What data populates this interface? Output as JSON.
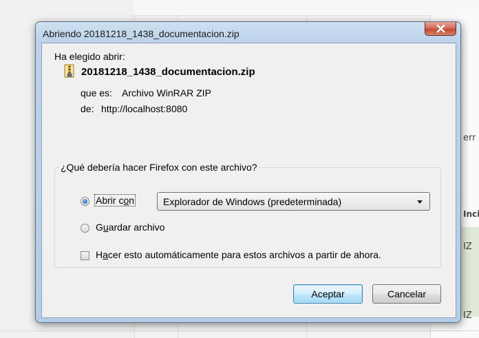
{
  "window": {
    "title": "Abriendo 20181218_1438_documentacion.zip"
  },
  "content": {
    "chosen_label": "Ha elegido abrir:",
    "file_name": "20181218_1438_documentacion.zip",
    "type_prefix": "que es:",
    "type_value": "Archivo WinRAR ZIP",
    "from_prefix": "de:",
    "from_value": "http://localhost:8080"
  },
  "group": {
    "legend": "¿Qué debería hacer Firefox con este archivo?",
    "open_with": {
      "label_before": "Abrir c",
      "label_accel": "o",
      "label_after": "n",
      "checked": true
    },
    "app_select": {
      "value": "Explorador de Windows (predeterminada)"
    },
    "save_file": {
      "label_before": "G",
      "label_accel": "u",
      "label_after": "ardar archivo",
      "checked": false
    },
    "auto": {
      "label_before": "H",
      "label_accel": "a",
      "label_after": "cer esto automáticamente para estos archivos a partir de ahora.",
      "checked": false
    }
  },
  "buttons": {
    "ok": "Aceptar",
    "cancel": "Cancelar"
  },
  "background": {
    "fragment_1": "err",
    "fragment_2": "Inci",
    "fragment_3": "IZ",
    "fragment_4": "IZ"
  },
  "icons": {
    "close": "close-icon",
    "file": "winrar-zip-icon",
    "dropdown": "chevron-down-icon"
  }
}
